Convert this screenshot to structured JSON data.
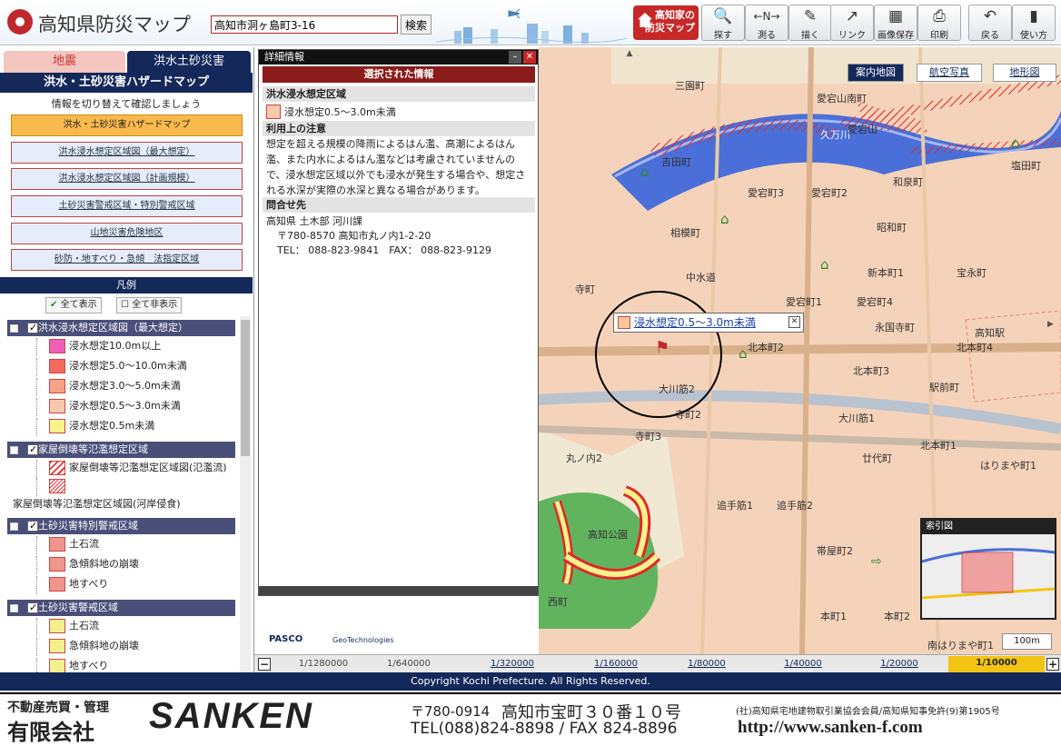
{
  "header": {
    "app_title": "高知県防災マップ",
    "search_value": "高知市洞ヶ島町3-16",
    "search_button": "検索",
    "home_plan_line1": "高知家の",
    "home_plan_line2": "防災マップ",
    "tools": [
      {
        "label": "探す",
        "icon": "magnifier-icon"
      },
      {
        "label": "測る",
        "icon": "ruler-icon"
      },
      {
        "label": "描く",
        "icon": "pen-icon"
      },
      {
        "label": "リンク",
        "icon": "link-icon"
      },
      {
        "label": "画像保存",
        "icon": "image-save-icon"
      },
      {
        "label": "印刷",
        "icon": "printer-icon"
      },
      {
        "label": "戻る",
        "icon": "back-icon"
      },
      {
        "label": "使い方",
        "icon": "help-icon"
      }
    ]
  },
  "sidebar": {
    "tab_earthquake": "地震",
    "tab_flood": "洪水土砂災害",
    "heading": "洪水・土砂災害ハザードマップ",
    "switch_note": "情報を切り替えて確認しましょう",
    "layers": [
      "洪水・土砂災害ハザードマップ",
      "洪水浸水想定区域図（最大想定）",
      "洪水浸水想定区域図（計画規模）",
      "土砂災害警戒区域・特別警戒区域",
      "山地災害危険地区",
      "砂防・地すべり・急傾　法指定区域"
    ],
    "legend_title": "凡例",
    "show_all": "全て表示",
    "hide_all": "全て非表示",
    "groups": [
      {
        "title": "洪水浸水想定区域図（最大想定）",
        "items": [
          {
            "label": "浸水想定10.0m以上",
            "color": "#f05fb8"
          },
          {
            "label": "浸水想定5.0～10.0m未満",
            "color": "#f26a5c"
          },
          {
            "label": "浸水想定3.0～5.0m未満",
            "color": "#f5a286"
          },
          {
            "label": "浸水想定0.5～3.0m未満",
            "color": "#f8c9aa"
          },
          {
            "label": "浸水想定0.5m未満",
            "color": "#f9f28c"
          }
        ]
      },
      {
        "title": "家屋倒壊等氾濫想定区域",
        "items": [
          {
            "label": "家屋倒壊等氾濫想定区域図(氾濫流)"
          }
        ],
        "extra": "家屋倒壊等氾濫想定区域図(河岸侵食)"
      },
      {
        "title": "土砂災害特別警戒区域",
        "items": [
          {
            "label": "土石流",
            "color": "#f0958c"
          },
          {
            "label": "急傾斜地の崩壊",
            "color": "#f0958c"
          },
          {
            "label": "地すべり",
            "color": "#f0958c"
          }
        ]
      },
      {
        "title": "土砂災害警戒区域",
        "items": [
          {
            "label": "土石流",
            "color": "#f3ef8c"
          },
          {
            "label": "急傾斜地の崩壊",
            "color": "#f3ef8c"
          },
          {
            "label": "地すべり",
            "color": "#f3ef8c"
          }
        ]
      }
    ]
  },
  "detail": {
    "title": "詳細情報",
    "selected": "選択された情報",
    "section1": "洪水浸水想定区域",
    "value1": "浸水想定0.5～3.0m未満",
    "section2": "利用上の注意",
    "note": "想定を超える規模の降雨によるはん濫、高潮によるはん濫、また内水によるはん濫などは考慮されていませんので、浸水想定区域以外でも浸水が発生する場合や、想定される水深が実際の水深と異なる場合があります。",
    "section3": "問合せ先",
    "contact1": "高知県 土木部 河川課",
    "contact2": "〒780-8570 高知市丸ノ内1-2-20",
    "contact3": "TEL： 088-823-9841　FAX： 088-823-9129",
    "pasco": "PASCO",
    "geotech": "GeoTechnologies"
  },
  "map": {
    "tabs": [
      "案内地図",
      "航空写真",
      "地形図"
    ],
    "popup": "浸水想定0.5～3.0m未満",
    "index_title": "索引図",
    "scale": "100m",
    "labels": [
      "三園町",
      "愛宕山南町",
      "久万川",
      "塩田町",
      "和泉町",
      "吉田町",
      "愛宕町3",
      "愛宕町2",
      "相模町",
      "昭和町",
      "新本町1",
      "宝永町",
      "中水道",
      "愛宕町1",
      "愛宕町4",
      "北本町2",
      "北本町3",
      "北本町4",
      "駅前町",
      "大川筋2",
      "大川筋1",
      "丸ノ内2",
      "高知公園",
      "廿代町",
      "はりまや町1",
      "追手筋1",
      "追手筋2",
      "帯屋町2",
      "北本町1",
      "西町",
      "本町1",
      "本町2",
      "南はりまや町1",
      "愛宕山",
      "寺町",
      "寺町3",
      "寺町2",
      "永国寺町",
      "高知駅"
    ]
  },
  "zoom": {
    "levels": [
      "1/1280000",
      "1/640000",
      "1/320000",
      "1/160000",
      "1/80000",
      "1/40000",
      "1/20000",
      "1/10000"
    ]
  },
  "copyright": "Copyright Kochi Prefecture. All Rights Reserved.",
  "banner": {
    "line1": "不動産売買・管理",
    "company": "有限会社",
    "brand": "SANKEN",
    "postal": "〒780-0914",
    "address": "高知市宝町３０番１０号",
    "tel": "TEL(088)824-8898 / FAX 824-8896",
    "association": "(社)高知県宅地建物取引業協会会員/高知県知事免許(9)第1905号",
    "url": "http://www.sanken-f.com"
  },
  "colors": {
    "navy": "#14285a",
    "red": "#c62828",
    "flood": "#f8c9aa",
    "active": "#f9b94c"
  }
}
